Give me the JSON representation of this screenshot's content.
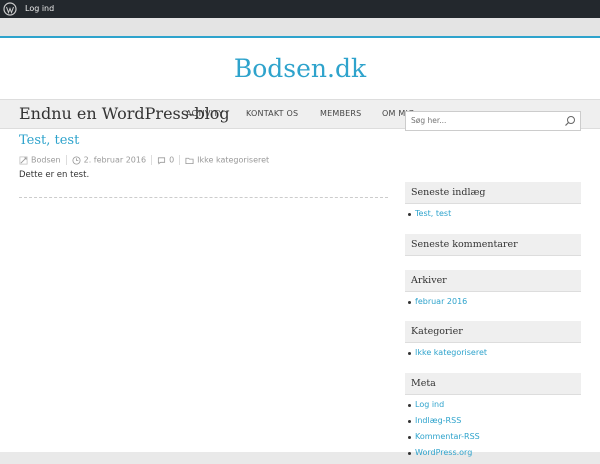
{
  "admin_bar": {
    "login_label": "Log ind"
  },
  "site": {
    "title": "Bodsen.dk"
  },
  "nav": {
    "items": [
      "ACTIVITY",
      "KONTAKT OS",
      "MEMBERS",
      "OM MIG"
    ]
  },
  "main": {
    "heading": "Endnu en WordPress-blog",
    "post": {
      "title": "Test, test",
      "author": "Bodsen",
      "date": "2. februar 2016",
      "comments": "0",
      "category": "Ikke kategoriseret",
      "excerpt": "Dette er en test."
    }
  },
  "sidebar": {
    "search_placeholder": "Søg her...",
    "recent_posts": {
      "title": "Seneste indlæg",
      "items": [
        "Test, test"
      ]
    },
    "recent_comments": {
      "title": "Seneste kommentarer"
    },
    "archives": {
      "title": "Arkiver",
      "items": [
        "februar 2016"
      ]
    },
    "categories": {
      "title": "Kategorier",
      "items": [
        "Ikke kategoriseret"
      ]
    },
    "meta": {
      "title": "Meta",
      "items": [
        "Log ind",
        "Indlæg-RSS",
        "Kommentar-RSS",
        "WordPress.org"
      ]
    }
  },
  "colors": {
    "accent": "#2ea3cc",
    "admin_bar": "#23282d"
  },
  "icons": {
    "admin_logo": "wordpress-logo-icon",
    "search": "search-icon",
    "author": "author-icon",
    "date": "clock-icon",
    "comments": "comment-icon",
    "category": "folder-icon"
  }
}
